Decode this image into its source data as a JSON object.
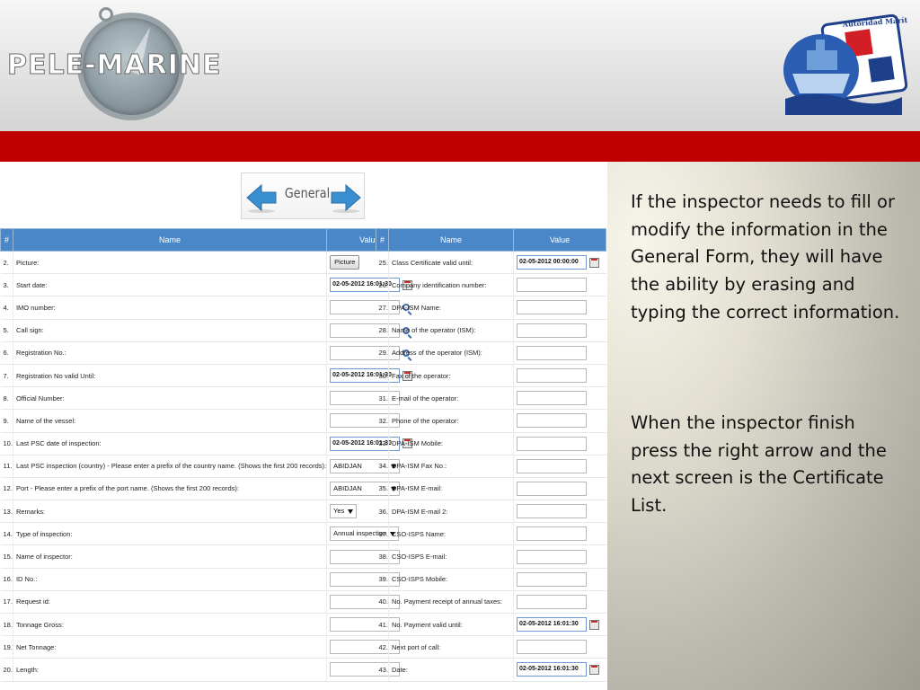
{
  "brand": {
    "name": "PELE-MARINE"
  },
  "seal": {
    "text": "Autoridad Marítima de Panamá"
  },
  "nav": {
    "title": "General",
    "prev": "previous-arrow",
    "next": "next-arrow"
  },
  "table_headers": {
    "num": "#",
    "name": "Name",
    "value": "Value"
  },
  "left_rows": [
    {
      "num": "2.",
      "name": "Picture:",
      "type": "button",
      "value": "Picture"
    },
    {
      "num": "3.",
      "name": "Start date:",
      "type": "date",
      "value": "02-05-2012 16:01:30"
    },
    {
      "num": "4.",
      "name": "IMO number:",
      "type": "search",
      "value": ""
    },
    {
      "num": "5.",
      "name": "Call sign:",
      "type": "search",
      "value": ""
    },
    {
      "num": "6.",
      "name": "Registration No.:",
      "type": "search",
      "value": ""
    },
    {
      "num": "7.",
      "name": "Registration No valid Until:",
      "type": "date",
      "value": "02-05-2012 16:01:30"
    },
    {
      "num": "8.",
      "name": "Official Number:",
      "type": "text",
      "value": ""
    },
    {
      "num": "9.",
      "name": "Name of the vessel:",
      "type": "text",
      "value": ""
    },
    {
      "num": "10.",
      "name": "Last PSC date of inspection:",
      "type": "date",
      "value": "02-05-2012 16:01:30"
    },
    {
      "num": "11.",
      "name": "Last PSC inspection (country) - Please enter a prefix of the country name. (Shows the first 200 records):",
      "type": "select",
      "value": "ABIDJAN"
    },
    {
      "num": "12.",
      "name": "Port - Please enter a prefix of the port name. (Shows the first 200 records):",
      "type": "select",
      "value": "ABIDJAN"
    },
    {
      "num": "13.",
      "name": "Remarks:",
      "type": "small-select",
      "value": "Yes"
    },
    {
      "num": "14.",
      "name": "Type of inspection:",
      "type": "small-select",
      "value": "Annual inspection"
    },
    {
      "num": "15.",
      "name": "Name of inspector:",
      "type": "text",
      "value": ""
    },
    {
      "num": "16.",
      "name": "ID No.:",
      "type": "text",
      "value": ""
    },
    {
      "num": "17.",
      "name": "Request id:",
      "type": "text",
      "value": ""
    },
    {
      "num": "18.",
      "name": "Tonnage Gross:",
      "type": "text",
      "value": ""
    },
    {
      "num": "19.",
      "name": "Net Tonnage:",
      "type": "text",
      "value": ""
    },
    {
      "num": "20.",
      "name": "Length:",
      "type": "text",
      "value": ""
    }
  ],
  "right_rows": [
    {
      "num": "25.",
      "name": "Class Certificate valid until:",
      "type": "date",
      "value": "02-05-2012 00:00:00"
    },
    {
      "num": "26.",
      "name": "Company identification number:",
      "type": "text",
      "value": ""
    },
    {
      "num": "27.",
      "name": "DPA-ISM Name:",
      "type": "text",
      "value": ""
    },
    {
      "num": "28.",
      "name": "Name of the operator (ISM):",
      "type": "text",
      "value": ""
    },
    {
      "num": "29.",
      "name": "Address of the operator (ISM):",
      "type": "text",
      "value": ""
    },
    {
      "num": "30.",
      "name": "Fax of the operator:",
      "type": "text",
      "value": ""
    },
    {
      "num": "31.",
      "name": "E-mail of the operator:",
      "type": "text",
      "value": ""
    },
    {
      "num": "32.",
      "name": "Phone of the operator:",
      "type": "text",
      "value": ""
    },
    {
      "num": "33.",
      "name": "DPA-ISM Mobile:",
      "type": "text",
      "value": ""
    },
    {
      "num": "34.",
      "name": "DPA-ISM Fax No.:",
      "type": "text",
      "value": ""
    },
    {
      "num": "35.",
      "name": "DPA-ISM E-mail:",
      "type": "text",
      "value": ""
    },
    {
      "num": "36.",
      "name": "DPA-ISM E-mail 2:",
      "type": "text",
      "value": ""
    },
    {
      "num": "37.",
      "name": "CSO-ISPS Name:",
      "type": "text",
      "value": ""
    },
    {
      "num": "38.",
      "name": "CSO-ISPS E-mail:",
      "type": "text",
      "value": ""
    },
    {
      "num": "39.",
      "name": "CSO-ISPS Mobile:",
      "type": "text",
      "value": ""
    },
    {
      "num": "40.",
      "name": "No. Payment receipt of annual taxes:",
      "type": "text",
      "value": ""
    },
    {
      "num": "41.",
      "name": "No. Payment valid until:",
      "type": "date",
      "value": "02-05-2012 16:01:30"
    },
    {
      "num": "42.",
      "name": "Next port of call:",
      "type": "text",
      "value": ""
    },
    {
      "num": "43.",
      "name": "Date:",
      "type": "date",
      "value": "02-05-2012 16:01:30"
    }
  ],
  "sidebar": {
    "paragraph1": "If the inspector needs to fill or modify the information in the General Form, they will have the ability by erasing and typing the correct information.",
    "paragraph2": "When the inspector finish press the right arrow and the next screen is the Certificate List."
  },
  "colors": {
    "header_blue": "#4a87c8",
    "red_bar": "#c00000"
  }
}
